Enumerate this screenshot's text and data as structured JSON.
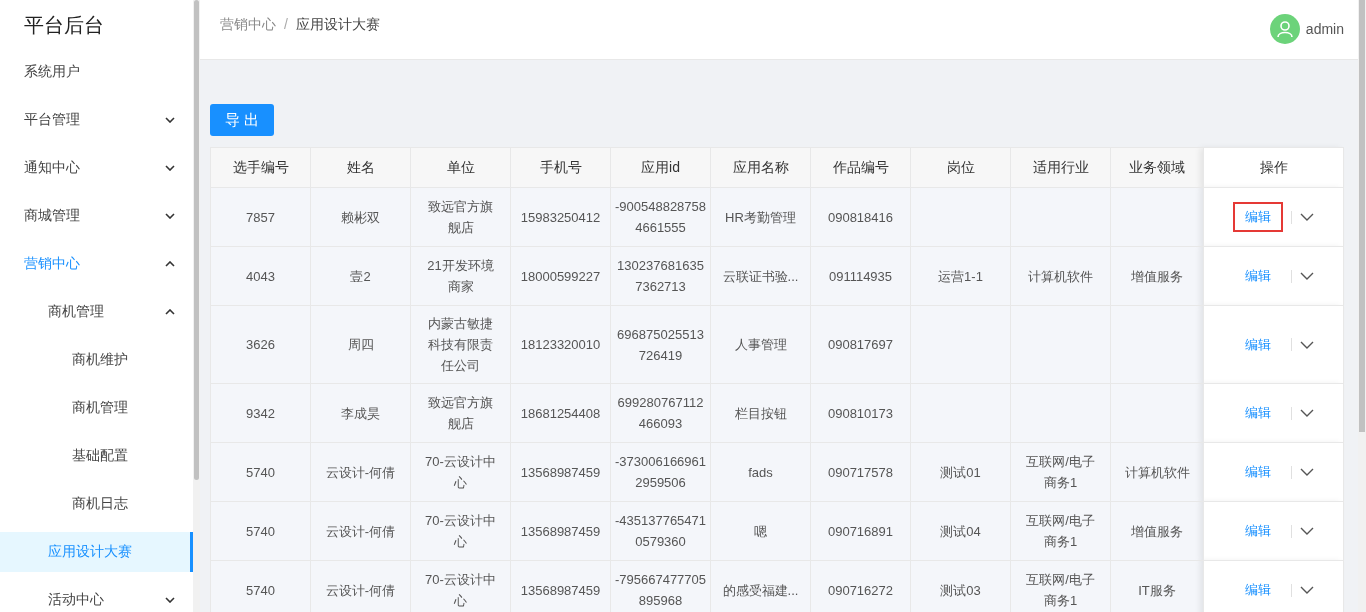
{
  "sidebar": {
    "title": "平台后台",
    "items": [
      {
        "label": "系统用户",
        "selected": false
      },
      {
        "label": "平台管理",
        "selected": false,
        "expanded": false
      },
      {
        "label": "通知中心",
        "selected": false,
        "expanded": false
      },
      {
        "label": "商城管理",
        "selected": false,
        "expanded": false
      },
      {
        "label": "营销中心",
        "selected": false,
        "active": true,
        "expanded": true,
        "children": [
          {
            "label": "商机管理",
            "selected": false,
            "expanded": true,
            "children": [
              {
                "label": "商机维护",
                "selected": false
              },
              {
                "label": "商机管理",
                "selected": false
              },
              {
                "label": "基础配置",
                "selected": false
              },
              {
                "label": "商机日志",
                "selected": false
              }
            ]
          },
          {
            "label": "应用设计大赛",
            "selected": true
          },
          {
            "label": "活动中心",
            "selected": false,
            "expanded": false
          }
        ]
      }
    ]
  },
  "breadcrumb": {
    "separator": "/",
    "items": [
      "营销中心",
      "应用设计大赛"
    ]
  },
  "user": {
    "name": "admin"
  },
  "toolbar": {
    "export_button": "导 出"
  },
  "table": {
    "columns": [
      "选手编号",
      "姓名",
      "单位",
      "手机号",
      "应用id",
      "应用名称",
      "作品编号",
      "岗位",
      "适用行业",
      "业务领域",
      "操作"
    ],
    "rows": [
      {
        "cells": [
          "7857",
          "赖彬双",
          "致远官方旗舰店",
          "15983250412",
          "-9005488287584661555",
          "HR考勤管理",
          "090818416",
          "",
          "",
          ""
        ],
        "action": "编辑",
        "highlighted": true
      },
      {
        "cells": [
          "4043",
          "壹2",
          "21开发环境商家",
          "18000599227",
          "1302376816357362713",
          "云联证书验...",
          "091114935",
          "运营1-1",
          "计算机软件",
          "增值服务"
        ],
        "action": "编辑",
        "highlighted": false
      },
      {
        "cells": [
          "3626",
          "周四",
          "内蒙古敏捷科技有限责任公司",
          "18123320010",
          "696875025513726419",
          "人事管理",
          "090817697",
          "",
          "",
          ""
        ],
        "action": "编辑",
        "highlighted": false
      },
      {
        "cells": [
          "9342",
          "李成昊",
          "致远官方旗舰店",
          "18681254408",
          "699280767112466093",
          "栏目按钮",
          "090810173",
          "",
          "",
          ""
        ],
        "action": "编辑",
        "highlighted": false
      },
      {
        "cells": [
          "5740",
          "云设计-何倩",
          "70-云设计中心",
          "13568987459",
          "-3730061669612959506",
          "fads",
          "090717578",
          "测试01",
          "互联网/电子商务1",
          "计算机软件"
        ],
        "action": "编辑",
        "highlighted": false
      },
      {
        "cells": [
          "5740",
          "云设计-何倩",
          "70-云设计中心",
          "13568987459",
          "-4351377654710579360",
          "嗯",
          "090716891",
          "测试04",
          "互联网/电子商务1",
          "增值服务"
        ],
        "action": "编辑",
        "highlighted": false
      },
      {
        "cells": [
          "5740",
          "云设计-何倩",
          "70-云设计中心",
          "13568987459",
          "-795667477705895968",
          "的感受福建...",
          "090716272",
          "测试03",
          "互联网/电子商务1",
          "IT服务"
        ],
        "action": "编辑",
        "highlighted": false
      }
    ]
  }
}
